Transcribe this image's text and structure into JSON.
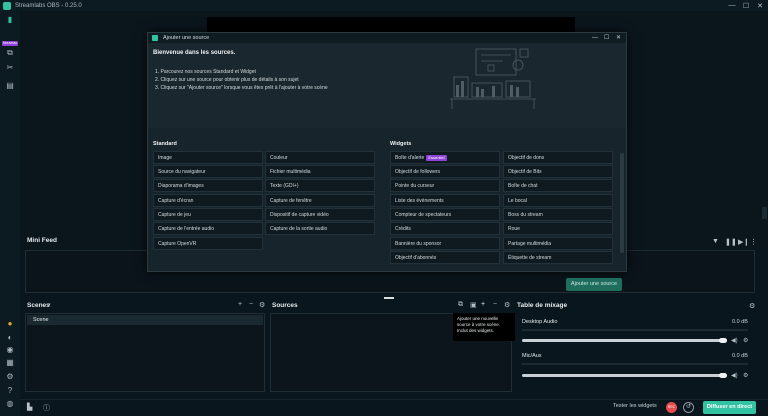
{
  "window": {
    "title": "Streamlabs OBS - 0.25.0",
    "controls": [
      "—",
      "☐",
      "✕"
    ]
  },
  "rail": {
    "badge": "Nouveau",
    "icons": [
      "studio-icon",
      "themes-icon",
      "tools-icon",
      "store-icon"
    ],
    "bottom_icons": [
      "alert-icon",
      "dashboard-icon",
      "cloud-icon",
      "grid-icon",
      "settings-icon",
      "help-icon",
      "profile-icon"
    ]
  },
  "minifeed": {
    "title": "Mini Feed"
  },
  "scenes": {
    "title": "Scenes",
    "items": [
      "Scene"
    ]
  },
  "sources": {
    "title": "Sources",
    "tooltip": "Ajouter une nouvelle source à votre scène. Inclut des widgets."
  },
  "mixer": {
    "title": "Table de mixage",
    "channels": [
      {
        "name": "Desktop Audio",
        "db": "0.0 dB",
        "level": 1.0
      },
      {
        "name": "Mic/Aux",
        "db": "0.0 dB",
        "level": 1.0
      }
    ]
  },
  "footer": {
    "test_widgets": "Tester les widgets",
    "rec_label": "REC",
    "go_live": "Diffuser en direct"
  },
  "modal": {
    "title": "Ajouter une source",
    "welcome": "Bienvenue dans les sources.",
    "steps": [
      "1. Parcourez nos sources Standard et Widget",
      "2. Cliquez sur une source pour obtenir plus de détails à son sujet",
      "3. Cliquez sur \"Ajouter source\" lorsque vous êtes prêt à l'ajouter à votre scène"
    ],
    "standard_title": "Standard",
    "widgets_title": "Widgets",
    "standard_col1": [
      "Image",
      "Source du navigateur",
      "Diaporama d'images",
      "Capture d'écran",
      "Capture de jeu",
      "Capture de l'entrée audio",
      "Capture OpenVR"
    ],
    "standard_col2": [
      "Couleur",
      "Fichier multimédia",
      "Texte (GDI+)",
      "Capture de fenêtre",
      "Dispositif de capture vidéo",
      "Capture de la sortie audio"
    ],
    "widgets_col1": [
      "Boîte d'alerte",
      "Objectif de followers",
      "Pointe du curseur",
      "Liste des événements",
      "Compteur de spectateurs",
      "Crédits",
      "Bannière du sponsor",
      "Objectif d'abonnés"
    ],
    "widgets_col2": [
      "Objectif de dons",
      "Objectif de Bits",
      "Boîte de chat",
      "Le bocal",
      "Boss du stream",
      "Roue",
      "Partage multimédia",
      "Étiquette de stream"
    ],
    "essential_badge": "Essentiel",
    "add_button": "Ajouter une source"
  }
}
